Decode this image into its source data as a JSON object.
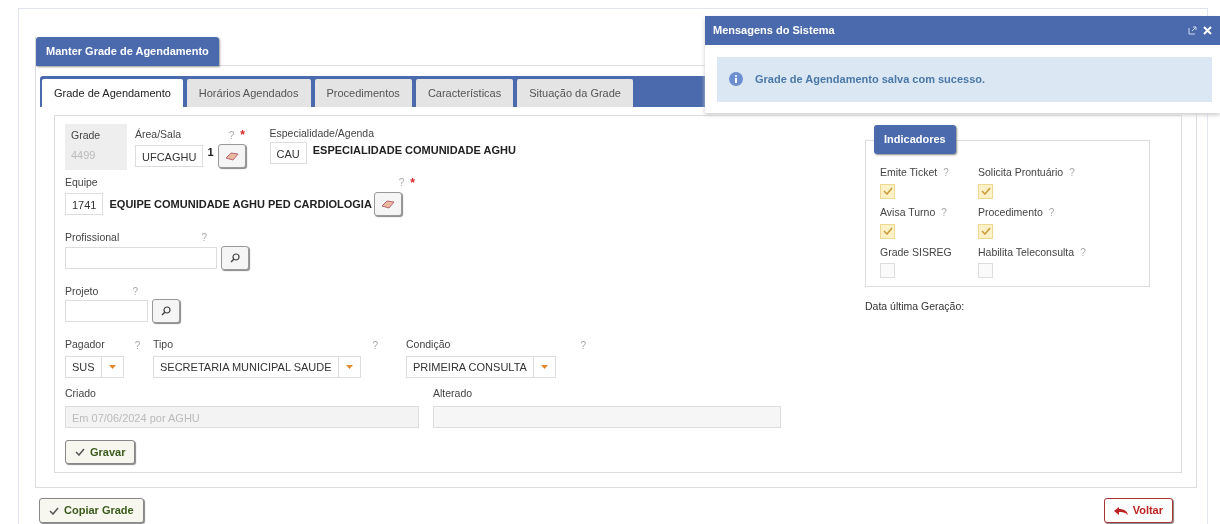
{
  "panel_title": "Manter Grade de Agendamento",
  "tabs": [
    {
      "label": "Grade de Agendamento",
      "selected": true
    },
    {
      "label": "Horários Agendados",
      "selected": false
    },
    {
      "label": "Procedimentos",
      "selected": false
    },
    {
      "label": "Características",
      "selected": false
    },
    {
      "label": "Situação da Grade",
      "selected": false
    }
  ],
  "grade": {
    "label": "Grade",
    "value": "4499",
    "disabled": true
  },
  "area_sala": {
    "label": "Área/Sala",
    "help": "?",
    "required": "*",
    "value": "UFCAGHU",
    "suffix": "1"
  },
  "especialidade": {
    "label": "Especialidade/Agenda",
    "code": "CAU",
    "name": "ESPECIALIDADE COMUNIDADE AGHU"
  },
  "equipe": {
    "label": "Equipe",
    "help": "?",
    "required": "*",
    "code": "1741",
    "name": "EQUIPE COMUNIDADE AGHU PED CARDIOLOGIA"
  },
  "profissional": {
    "label": "Profissional",
    "help": "?"
  },
  "projeto": {
    "label": "Projeto",
    "help": "?"
  },
  "pagador": {
    "label": "Pagador",
    "help": "?",
    "value": "SUS"
  },
  "tipo": {
    "label": "Tipo",
    "help": "?",
    "value": "SECRETARIA MUNICIPAL SAUDE"
  },
  "condicao": {
    "label": "Condição",
    "help": "?",
    "value": "PRIMEIRA CONSULTA"
  },
  "criado": {
    "label": "Criado",
    "value": "Em 07/06/2024 por AGHU",
    "disabled": true
  },
  "alterado": {
    "label": "Alterado"
  },
  "save_button": "Gravar",
  "indicadores": {
    "title": "Indicadores",
    "items": [
      {
        "label": "Emite Ticket",
        "help": "?",
        "checked": true
      },
      {
        "label": "Solicita Prontuário",
        "help": "?",
        "checked": true
      },
      {
        "label": "Avisa Turno",
        "help": "?",
        "checked": true
      },
      {
        "label": "Procedimento",
        "help": "?",
        "checked": true
      },
      {
        "label": "Grade SISREG",
        "checked": false
      },
      {
        "label": "Habilita Teleconsulta",
        "help": "?",
        "checked": false
      }
    ]
  },
  "data_ultima_geracao": "Data última Geração:",
  "copy_button": "Copiar Grade",
  "back_button": "Voltar",
  "messages": {
    "title": "Mensagens do Sistema",
    "text": "Grade de Agendamento salva com sucesso."
  }
}
